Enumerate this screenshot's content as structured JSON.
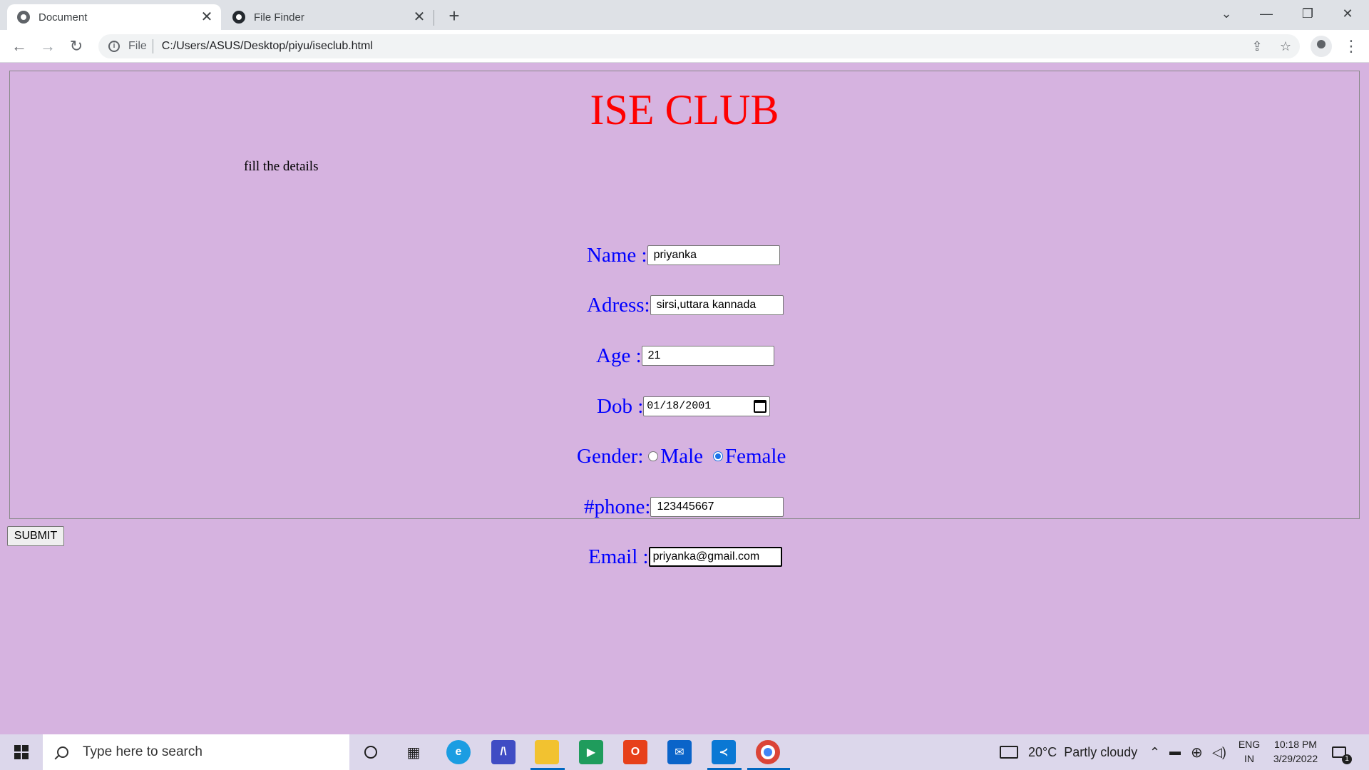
{
  "browser": {
    "tabs": [
      {
        "title": "Document",
        "active": true,
        "icon": "globe-icon"
      },
      {
        "title": "File Finder",
        "active": false,
        "icon": "github-icon"
      }
    ],
    "close_glyph": "✕",
    "new_tab_glyph": "+",
    "window_controls": {
      "dropdown": "⌄",
      "minimize": "—",
      "restore": "❐",
      "close": "✕"
    },
    "nav": {
      "back": "←",
      "forward": "→",
      "reload": "↻"
    },
    "address": {
      "scheme_label": "File",
      "url": "C:/Users/ASUS/Desktop/piyu/iseclub.html"
    },
    "toolbar_glyphs": {
      "share": "⇪",
      "star": "☆",
      "menu": "⋮"
    }
  },
  "page": {
    "background": "#d6b3e0",
    "title": "ISE CLUB",
    "title_color": "#ff0000",
    "hint": "fill the details",
    "label_color": "#0000ff",
    "fields": {
      "name": {
        "label": "Name :",
        "value": "priyanka"
      },
      "address": {
        "label": "Adress:",
        "value": "sirsi,uttara kannada"
      },
      "age": {
        "label": "Age :",
        "value": "21"
      },
      "dob": {
        "label": "Dob :",
        "value": "01/18/2001"
      },
      "gender": {
        "label": "Gender:",
        "options": [
          "Male",
          "Female"
        ],
        "selected": "Female"
      },
      "phone": {
        "label": "#phone:",
        "value": "123445667"
      },
      "email": {
        "label": "Email :",
        "value": "priyanka@gmail.com"
      }
    },
    "submit_label": "SUBMIT"
  },
  "taskbar": {
    "search_placeholder": "Type here to search",
    "apps": [
      "cortana-icon",
      "task-view-icon",
      "edge-icon",
      "vs-code-insiders-icon",
      "file-explorer-icon",
      "zoom-icon",
      "office-icon",
      "mail-icon",
      "vscode-icon",
      "chrome-icon"
    ],
    "weather": {
      "temp": "20°C",
      "condition": "Partly cloudy"
    },
    "language": {
      "line1": "ENG",
      "line2": "IN"
    },
    "clock": {
      "time": "10:18 PM",
      "date": "3/29/2022"
    },
    "notifications_count": "1"
  }
}
